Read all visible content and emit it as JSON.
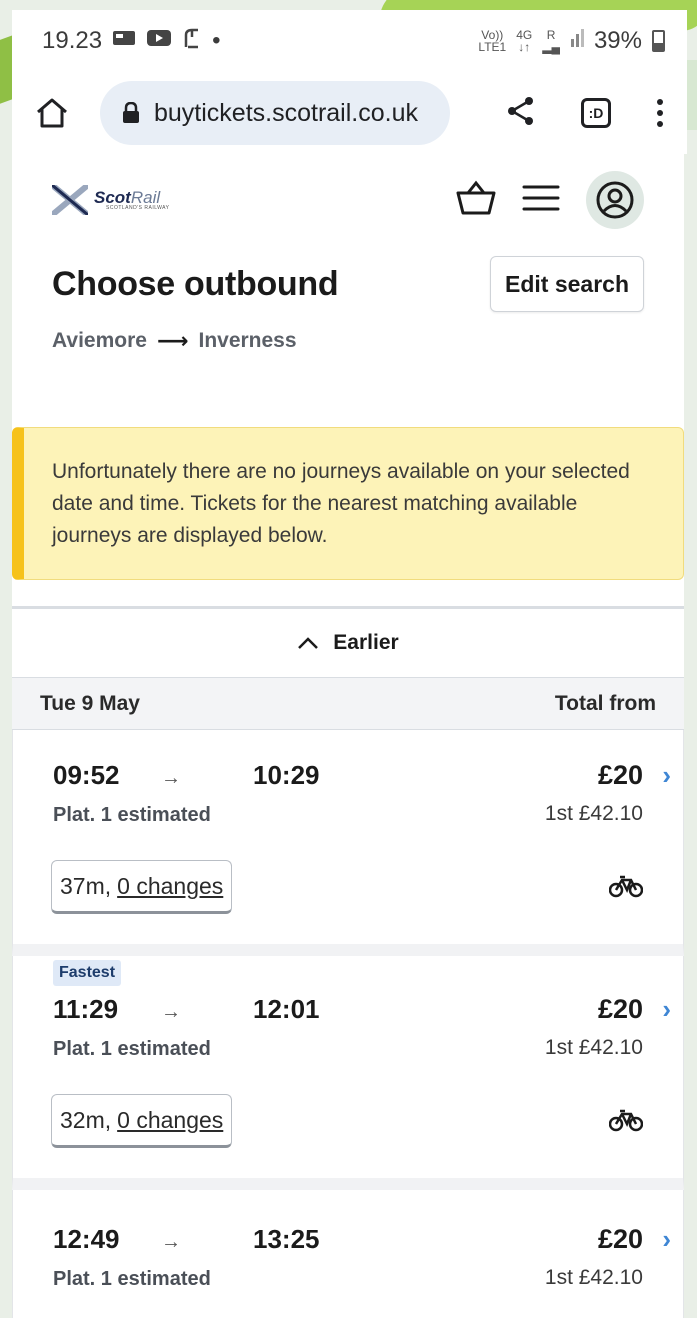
{
  "status_bar": {
    "time": "19.23",
    "network_top": "Vo))",
    "network_bottom": "LTE1",
    "signal_type": "4G",
    "signal_roaming": "R",
    "battery": "39%"
  },
  "browser": {
    "url": "buytickets.scotrail.co.uk",
    "tab_label": ":D"
  },
  "header": {
    "brand_main": "Scot",
    "brand_accent": "Rail",
    "brand_tag": "SCOTLAND'S RAILWAY"
  },
  "page": {
    "title": "Choose outbound",
    "edit_search": "Edit search",
    "origin": "Aviemore",
    "arrow": "⟶",
    "destination": "Inverness"
  },
  "notice": {
    "text": "Unfortunately there are no journeys available on your selected date and time. Tickets for the nearest matching available journeys are displayed below."
  },
  "results": {
    "earlier_label": "Earlier",
    "date": "Tue 9 May",
    "total_from": "Total from",
    "journeys": [
      {
        "badge": "",
        "depart": "09:52",
        "arrow": "→",
        "arrive": "10:29",
        "platform": "Plat. 1 estimated",
        "price": "£20",
        "first_class": "1st £42.10",
        "duration": "37m,",
        "changes": "0 changes"
      },
      {
        "badge": "Fastest",
        "depart": "11:29",
        "arrow": "→",
        "arrive": "12:01",
        "platform": "Plat. 1 estimated",
        "price": "£20",
        "first_class": "1st £42.10",
        "duration": "32m,",
        "changes": "0 changes"
      },
      {
        "badge": "",
        "depart": "12:49",
        "arrow": "→",
        "arrive": "13:25",
        "platform": "Plat. 1 estimated",
        "price": "£20",
        "first_class": "1st £42.10"
      }
    ]
  },
  "colors": {
    "notice_bg": "#fdf3b8",
    "notice_accent": "#f6c21b",
    "chevron": "#3f86d4",
    "badge_bg": "#dfe9f7"
  }
}
